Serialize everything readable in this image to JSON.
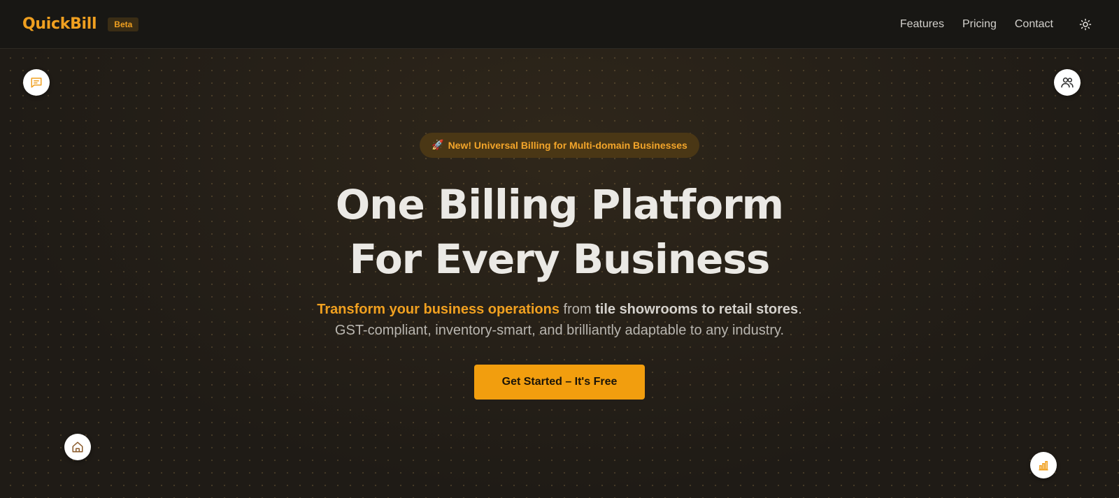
{
  "header": {
    "logo": "QuickBill",
    "badge": "Beta",
    "nav": [
      {
        "label": "Features"
      },
      {
        "label": "Pricing"
      },
      {
        "label": "Contact"
      }
    ],
    "theme_icon": "sun-icon"
  },
  "floating_icons": [
    "message-icon",
    "users-icon",
    "home-icon",
    "bar-chart-icon"
  ],
  "hero": {
    "announcement_icon": "🚀",
    "announcement": "New! Universal Billing for Multi-domain Businesses",
    "headline_line1": "One Billing Platform",
    "headline_line2": "For Every Business",
    "sub_highlight": "Transform your business operations",
    "sub_from": "from",
    "sub_strong": "tile showrooms to retail stores",
    "sub_period": ".",
    "sub_line2": "GST-compliant, inventory-smart, and brilliantly adaptable to any industry.",
    "cta": "Get Started – It's Free"
  },
  "colors": {
    "accent": "#f0a020",
    "background": "#1f1b16",
    "header_bg": "#181714"
  }
}
